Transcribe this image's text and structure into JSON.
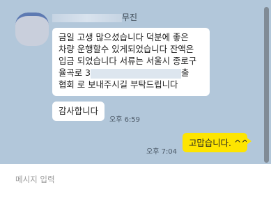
{
  "chat": {
    "sender_name": "무진",
    "messages_in": {
      "message_1_lines": [
        "금일 고생 많으셨습니다 덕분에 좋은",
        "차량 운행할수 있게되었습니다 잔액은",
        "입금 되었습니다 서류는 서울시 종로구",
        "율곡로 3",
        "출",
        "협회 로 보내주시길 부탁드립니다"
      ],
      "message_2": "감사합니다",
      "time": "오후 6:59"
    },
    "message_out": {
      "text": "고맙습니다. ^^",
      "time": "오후 7:04"
    }
  },
  "input": {
    "placeholder": "메시지 입력",
    "value": ""
  },
  "colors": {
    "chat_background": "#b2c7da",
    "incoming_bubble": "#ffffff",
    "outgoing_bubble": "#fee500",
    "scrollbar": "#808b96"
  }
}
